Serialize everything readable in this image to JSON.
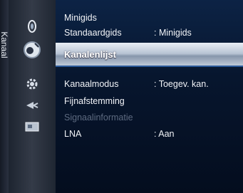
{
  "side_label": "Kanaal",
  "icons": [
    "picture-icon",
    "channel-icon",
    "setup-icon",
    "input-icon",
    "application-icon"
  ],
  "menu": {
    "minigids": "Minigids",
    "standaardgids": {
      "label": "Standaardgids",
      "value": ": Minigids"
    },
    "kanalenlijst": "Kanalenlijst",
    "kanaalmodus": {
      "label": "Kanaalmodus",
      "value": ": Toegev. kan."
    },
    "fijnafstemming": "Fijnafstemming",
    "signaalinformatie": "Signaalinformatie",
    "lna": {
      "label": "LNA",
      "value": ": Aan"
    }
  },
  "colors": {
    "highlight": "#c7d1de",
    "background": "#07142a",
    "disabled_text": "#5d6a80"
  }
}
